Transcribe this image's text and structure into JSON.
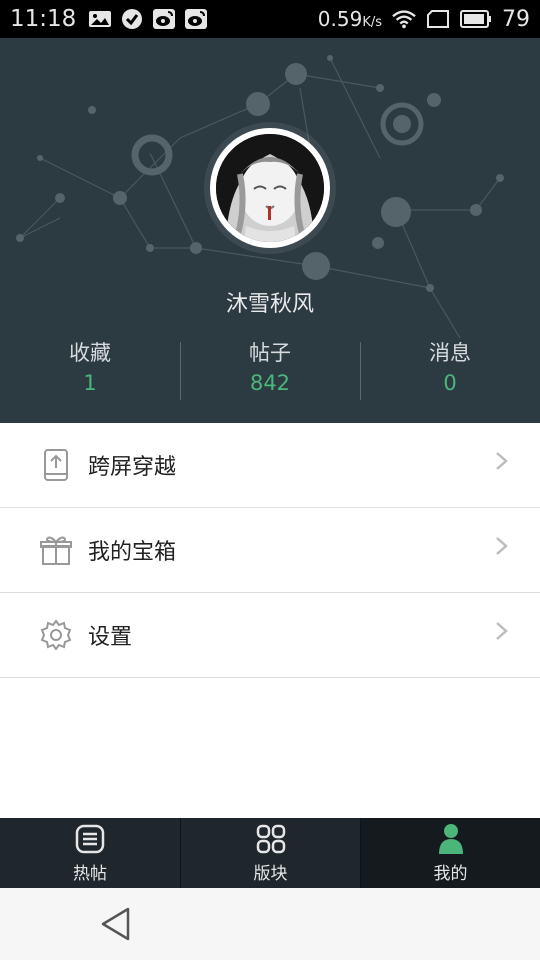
{
  "status_bar": {
    "time": "11:18",
    "icons": [
      "image-icon",
      "check-circle-icon",
      "weibo-icon",
      "weibo-icon"
    ],
    "net_speed": "0.59",
    "net_speed_unit": "K/s",
    "battery": "79"
  },
  "profile": {
    "username": "沐雪秋风",
    "stats": [
      {
        "label": "收藏",
        "value": "1"
      },
      {
        "label": "帖子",
        "value": "842"
      },
      {
        "label": "消息",
        "value": "0"
      }
    ]
  },
  "menu": {
    "items": [
      {
        "label": "跨屏穿越",
        "icon": "phone-upload-icon"
      },
      {
        "label": "我的宝箱",
        "icon": "gift-icon"
      },
      {
        "label": "设置",
        "icon": "gear-icon"
      }
    ]
  },
  "tabbar": {
    "tabs": [
      {
        "label": "热帖",
        "icon": "list-icon",
        "active": false
      },
      {
        "label": "版块",
        "icon": "grid-icon",
        "active": false
      },
      {
        "label": "我的",
        "icon": "user-icon",
        "active": true
      }
    ]
  },
  "colors": {
    "header_bg": "#2c3a42",
    "accent_green": "#4cb57a",
    "tab_bg": "#1f262c"
  }
}
